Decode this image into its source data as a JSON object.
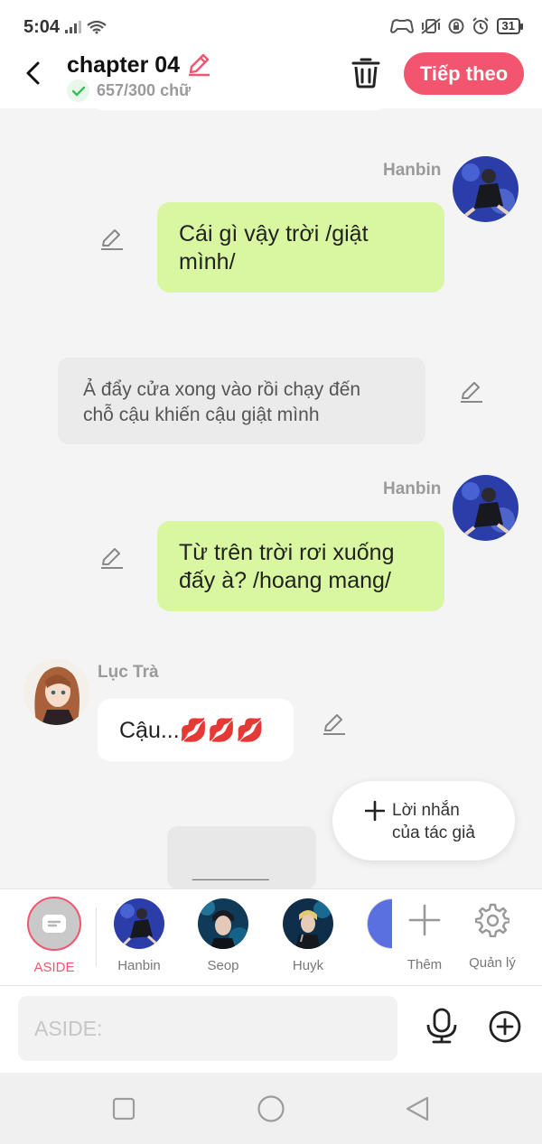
{
  "status_bar": {
    "time": "5:04",
    "battery": "31"
  },
  "header": {
    "title": "chapter 04",
    "word_count": "657/300 chữ",
    "next_label": "Tiếp theo"
  },
  "messages": [
    {
      "type": "right",
      "name": "Hanbin",
      "text_lines": [
        "Cái gì vậy trời /giật",
        "mình/"
      ]
    },
    {
      "type": "narration",
      "text_lines": [
        "Ả đẩy cửa xong vào rồi chạy đến",
        "chỗ cậu khiến cậu giật mình"
      ]
    },
    {
      "type": "right",
      "name": "Hanbin",
      "text_lines": [
        "Từ trên trời rơi xuống",
        "đấy à? /hoang mang/"
      ]
    },
    {
      "type": "left",
      "name": "Lục Trà",
      "text": "Cậu...💋💋💋"
    }
  ],
  "partial_bubble": "________",
  "author_note": {
    "line1": "Lời nhắn",
    "line2": "của tác giả"
  },
  "characters": [
    {
      "label": "ASIDE"
    },
    {
      "label": "Hanbin"
    },
    {
      "label": "Seop"
    },
    {
      "label": "Huyk"
    }
  ],
  "actions": {
    "add_label": "Thêm",
    "manage_label": "Quản lý"
  },
  "input": {
    "placeholder": "ASIDE:"
  },
  "colors": {
    "accent": "#f2566f",
    "bubble_green": "#d9f7a0",
    "narration_bg": "#ebebeb"
  }
}
